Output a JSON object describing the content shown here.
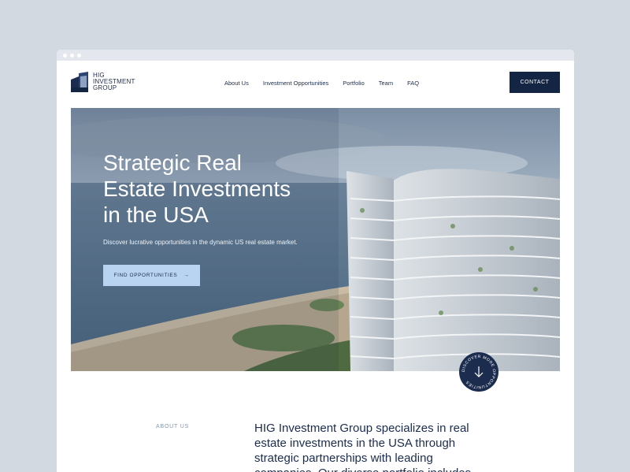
{
  "logo": {
    "line1": "HIG",
    "line2": "INVESTMENT",
    "line3": "GROUP"
  },
  "nav": {
    "items": [
      {
        "label": "About Us"
      },
      {
        "label": "Investment Opportunities"
      },
      {
        "label": "Portfolio"
      },
      {
        "label": "Team"
      },
      {
        "label": "FAQ"
      }
    ],
    "contact_label": "CONTACT"
  },
  "hero": {
    "title_line1": "Strategic Real",
    "title_line2": "Estate Investments",
    "title_line3": "in the USA",
    "subtitle": "Discover lucrative opportunities in the dynamic US real estate market.",
    "cta_label": "FIND OPPORTUNITIES",
    "cta_icon": "arrow-right-icon"
  },
  "discover_badge": {
    "text": "DISCOVER MORE OPPORTUNITIES",
    "icon": "arrow-down-icon"
  },
  "about": {
    "label": "ABOUT US",
    "text": "HIG Investment Group specializes in real estate investments in the USA through strategic partnerships with leading companies. Our diverse portfolio includes"
  },
  "colors": {
    "navy": "#142443",
    "accent_light_blue": "#b8d4f0",
    "page_bg": "#d3d9e1"
  }
}
